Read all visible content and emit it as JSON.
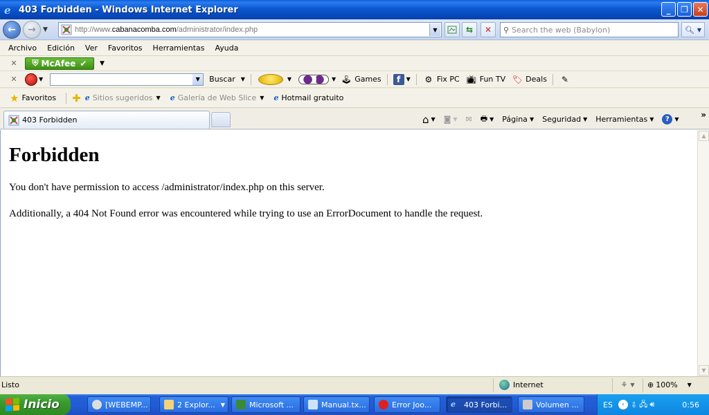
{
  "window": {
    "title": "403 Forbidden - Windows Internet Explorer"
  },
  "address_bar": {
    "url_prefix": "http://www.",
    "url_domain": "cabanacomba.com",
    "url_path": "/administrator/index.php",
    "search_placeholder": "Search the web (Babylon)"
  },
  "menu": {
    "items": [
      "Archivo",
      "Edición",
      "Ver",
      "Favoritos",
      "Herramientas",
      "Ayuda"
    ]
  },
  "toolbar1": {
    "mcafee_label": "McAfee"
  },
  "toolbar2": {
    "buscar_label": "Buscar",
    "games_label": "Games",
    "fixpc_label": "Fix PC",
    "funtv_label": "Fun TV",
    "deals_label": "Deals"
  },
  "favorites_bar": {
    "favorites_label": "Favoritos",
    "items": [
      "Sitios sugeridos",
      "Galería de Web Slice",
      "Hotmail gratuito"
    ]
  },
  "tabs": {
    "active_tab": "403 Forbidden"
  },
  "command_bar": {
    "page_label": "Página",
    "security_label": "Seguridad",
    "tools_label": "Herramientas"
  },
  "content": {
    "heading": "Forbidden",
    "paragraph1": "You don't have permission to access /administrator/index.php on this server.",
    "paragraph2": "Additionally, a 404 Not Found error was encountered while trying to use an ErrorDocument to handle the request."
  },
  "status_bar": {
    "status_text": "Listo",
    "zone_text": "Internet",
    "zoom_text": "100%"
  },
  "taskbar": {
    "start_label": "Inicio",
    "tasks": [
      "[WEBEMP...",
      "2 Explor...",
      "Microsoft ...",
      "Manual.tx...",
      "Error Joo...",
      "403 Forbi...",
      "Volumen ..."
    ],
    "language": "ES",
    "clock": "0:56"
  },
  "colors": {
    "titlebar_blue": "#0a58d0",
    "taskbar_blue": "#225bd4",
    "start_green": "#3a9a2e",
    "mcafee_green": "#3e8e16"
  }
}
